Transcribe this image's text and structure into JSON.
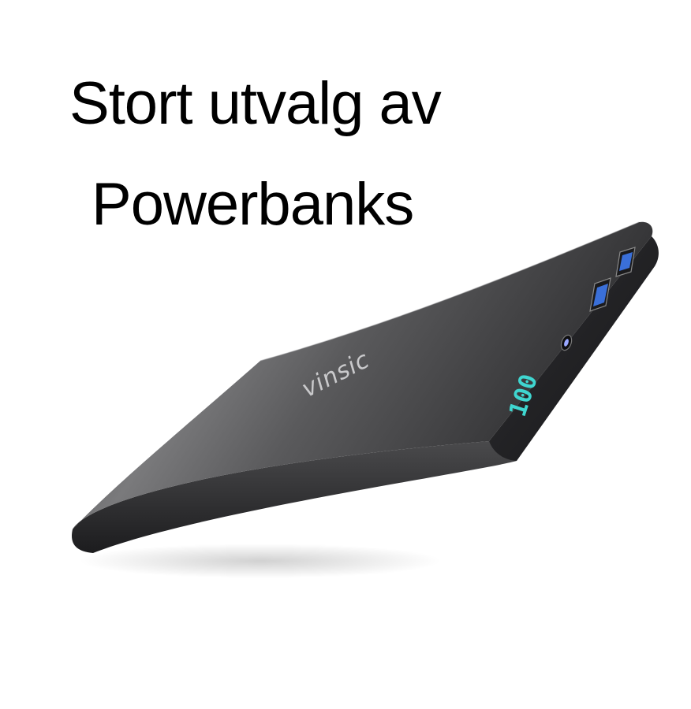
{
  "headline": {
    "line1": "Stort utvalg av",
    "line2": "Powerbanks"
  },
  "product": {
    "brand_text": "vinsic",
    "display_value": "100",
    "display_color": "#3fd6d0",
    "usb_port_color": "#3a6fd8",
    "body_color": "#2b2b2d"
  }
}
